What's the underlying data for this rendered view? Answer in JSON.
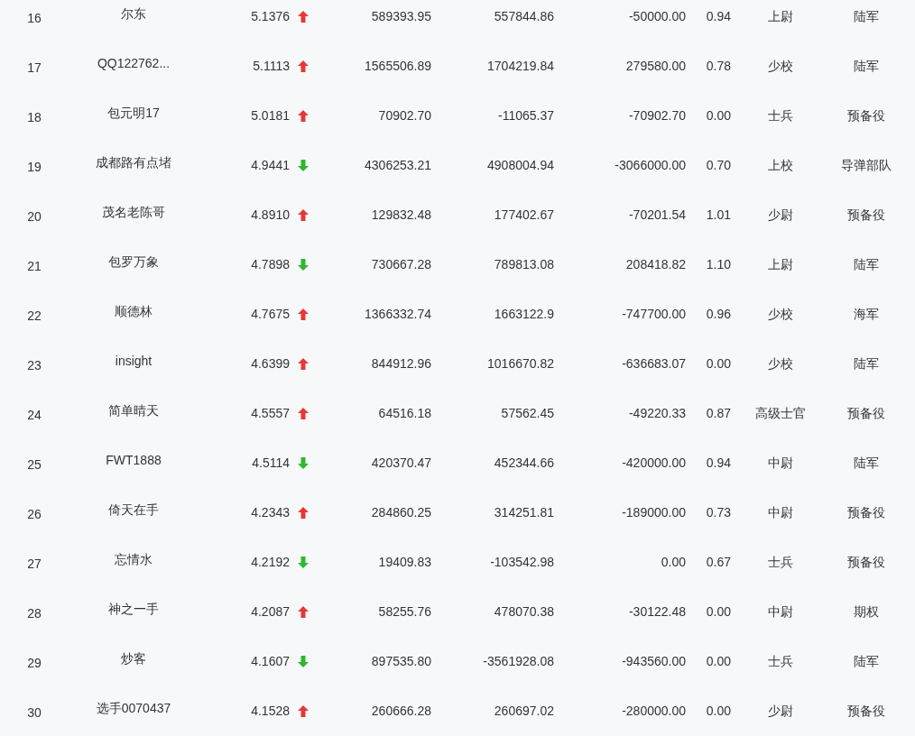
{
  "rows": [
    {
      "rank": "16",
      "name": "尔东",
      "ratio": "5.1376",
      "kind": "up",
      "column_4": "589393.95",
      "column_5": "557844.86",
      "column_6": "-50000.00",
      "column_7": "0.94",
      "rank_title": "上尉",
      "branch": "陆军"
    },
    {
      "rank": "17",
      "name": "QQ122762...",
      "ratio": "5.1113",
      "kind": "up",
      "column_4": "1565506.89",
      "column_5": "1704219.84",
      "column_6": "279580.00",
      "column_7": "0.78",
      "rank_title": "少校",
      "branch": "陆军"
    },
    {
      "rank": "18",
      "name": "包元明17",
      "ratio": "5.0181",
      "kind": "up",
      "column_4": "70902.70",
      "column_5": "-11065.37",
      "column_6": "-70902.70",
      "column_7": "0.00",
      "rank_title": "士兵",
      "branch": "预备役"
    },
    {
      "rank": "19",
      "name": "成都路有点堵",
      "ratio": "4.9441",
      "kind": "down",
      "column_4": "4306253.21",
      "column_5": "4908004.94",
      "column_6": "-3066000.00",
      "column_7": "0.70",
      "rank_title": "上校",
      "branch": "导弹部队"
    },
    {
      "rank": "20",
      "name": "茂名老陈哥",
      "ratio": "4.8910",
      "kind": "up",
      "column_4": "129832.48",
      "column_5": "177402.67",
      "column_6": "-70201.54",
      "column_7": "1.01",
      "rank_title": "少尉",
      "branch": "预备役"
    },
    {
      "rank": "21",
      "name": "包罗万象",
      "ratio": "4.7898",
      "kind": "down",
      "column_4": "730667.28",
      "column_5": "789813.08",
      "column_6": "208418.82",
      "column_7": "1.10",
      "rank_title": "上尉",
      "branch": "陆军"
    },
    {
      "rank": "22",
      "name": "顺德林",
      "ratio": "4.7675",
      "kind": "up",
      "column_4": "1366332.74",
      "column_5": "1663122.9",
      "column_6": "-747700.00",
      "column_7": "0.96",
      "rank_title": "少校",
      "branch": "海军"
    },
    {
      "rank": "23",
      "name": "insight",
      "ratio": "4.6399",
      "kind": "up",
      "column_4": "844912.96",
      "column_5": "1016670.82",
      "column_6": "-636683.07",
      "column_7": "0.00",
      "rank_title": "少校",
      "branch": "陆军"
    },
    {
      "rank": "24",
      "name": "简单晴天",
      "ratio": "4.5557",
      "kind": "up",
      "column_4": "64516.18",
      "column_5": "57562.45",
      "column_6": "-49220.33",
      "column_7": "0.87",
      "rank_title": "高级士官",
      "branch": "预备役"
    },
    {
      "rank": "25",
      "name": "FWT1888",
      "ratio": "4.5114",
      "kind": "down",
      "column_4": "420370.47",
      "column_5": "452344.66",
      "column_6": "-420000.00",
      "column_7": "0.94",
      "rank_title": "中尉",
      "branch": "陆军"
    },
    {
      "rank": "26",
      "name": "倚天在手",
      "ratio": "4.2343",
      "kind": "up",
      "column_4": "284860.25",
      "column_5": "314251.81",
      "column_6": "-189000.00",
      "column_7": "0.73",
      "rank_title": "中尉",
      "branch": "预备役"
    },
    {
      "rank": "27",
      "name": "忘情水",
      "ratio": "4.2192",
      "kind": "down",
      "column_4": "19409.83",
      "column_5": "-103542.98",
      "column_6": "0.00",
      "column_7": "0.67",
      "rank_title": "士兵",
      "branch": "预备役"
    },
    {
      "rank": "28",
      "name": "神之一手",
      "ratio": "4.2087",
      "kind": "up",
      "column_4": "58255.76",
      "column_5": "478070.38",
      "column_6": "-30122.48",
      "column_7": "0.00",
      "rank_title": "中尉",
      "branch": "期权"
    },
    {
      "rank": "29",
      "name": "炒客",
      "ratio": "4.1607",
      "kind": "down",
      "column_4": "897535.80",
      "column_5": "-3561928.08",
      "column_6": "-943560.00",
      "column_7": "0.00",
      "rank_title": "士兵",
      "branch": "陆军"
    },
    {
      "rank": "30",
      "name": "选手0070437",
      "ratio": "4.1528",
      "kind": "up",
      "column_4": "260666.28",
      "column_5": "260697.02",
      "column_6": "-280000.00",
      "column_7": "0.00",
      "rank_title": "少尉",
      "branch": "预备役"
    }
  ]
}
